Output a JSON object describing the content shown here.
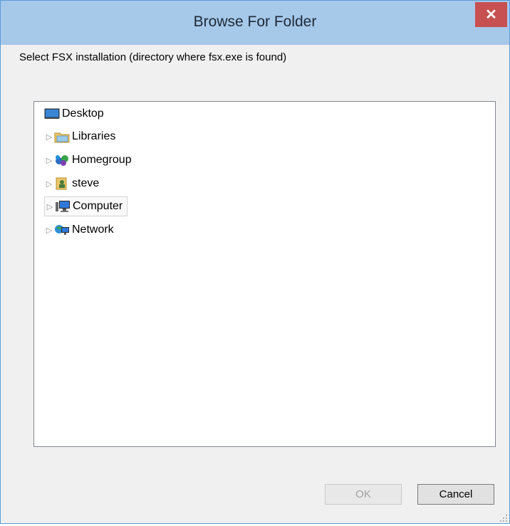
{
  "window": {
    "title": "Browse For Folder",
    "close_glyph": "✕"
  },
  "instruction": "Select FSX installation (directory where fsx.exe is found)",
  "tree": {
    "items": [
      {
        "label": "Desktop",
        "icon": "desktop-icon",
        "expandable": false
      },
      {
        "label": "Libraries",
        "icon": "libraries-icon",
        "expandable": true
      },
      {
        "label": "Homegroup",
        "icon": "homegroup-icon",
        "expandable": true
      },
      {
        "label": "steve",
        "icon": "user-folder-icon",
        "expandable": true
      },
      {
        "label": "Computer",
        "icon": "computer-icon",
        "expandable": true,
        "highlighted": true
      },
      {
        "label": "Network",
        "icon": "network-icon",
        "expandable": true
      }
    ],
    "expander_glyph": "▷"
  },
  "buttons": {
    "ok_label": "OK",
    "ok_enabled": false,
    "cancel_label": "Cancel"
  },
  "colors": {
    "titlebar": "#a6c8e9",
    "close_button": "#c75050",
    "window_border": "#5a9bd5"
  }
}
